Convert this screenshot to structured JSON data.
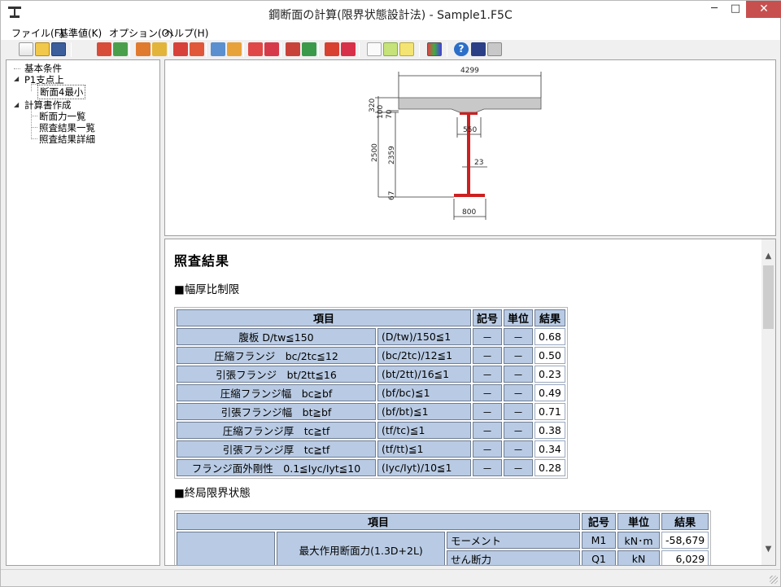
{
  "window": {
    "title": "鋼断面の計算(限界状態設計法) - Sample1.F5C",
    "min": "─",
    "max": "□",
    "close": "✕"
  },
  "menu": [
    "ファイル(F)",
    "基準値(K)",
    "オプション(O)",
    "ヘルプ(H)"
  ],
  "tree": {
    "basic": "基本条件",
    "p1": "P1支点上",
    "section": "断面4最小",
    "report": "計算書作成",
    "forces": "断面力一覧",
    "results": "照査結果一覧",
    "detail": "照査結果詳細"
  },
  "drawing": {
    "top_width": "4299",
    "slab": "320",
    "haunch": "100",
    "flange_top": "70",
    "web_depth": "2500",
    "web_clear": "2359",
    "flange_bot": "67",
    "top_flange_w": "550",
    "web_t": "23",
    "bot_flange_w": "800"
  },
  "results": {
    "heading": "照査結果",
    "sec1": "■幅厚比制限",
    "sec2": "■終局限界状態",
    "t1_head": {
      "item": "項目",
      "symbol": "記号",
      "unit": "単位",
      "result": "結果"
    },
    "t1_rows": [
      {
        "name": "腹板 D/tw≦150",
        "formula": "(D/tw)/150≦1",
        "symbol": "－",
        "unit": "－",
        "value": "0.68"
      },
      {
        "name": "圧縮フランジ　bc/2tc≦12",
        "formula": "(bc/2tc)/12≦1",
        "symbol": "－",
        "unit": "－",
        "value": "0.50"
      },
      {
        "name": "引張フランジ　bt/2tt≦16",
        "formula": "(bt/2tt)/16≦1",
        "symbol": "－",
        "unit": "－",
        "value": "0.23"
      },
      {
        "name": "圧縮フランジ幅　bc≧bf",
        "formula": "(bf/bc)≦1",
        "symbol": "－",
        "unit": "－",
        "value": "0.49"
      },
      {
        "name": "引張フランジ幅　bt≧bf",
        "formula": "(bf/bt)≦1",
        "symbol": "－",
        "unit": "－",
        "value": "0.71"
      },
      {
        "name": "圧縮フランジ厚　tc≧tf",
        "formula": "(tf/tc)≦1",
        "symbol": "－",
        "unit": "－",
        "value": "0.38"
      },
      {
        "name": "引張フランジ厚　tc≧tf",
        "formula": "(tf/tt)≦1",
        "symbol": "－",
        "unit": "－",
        "value": "0.34"
      },
      {
        "name": "フランジ面外剛性　0.1≦Iyc/Iyt≦10",
        "formula": "(Iyc/Iyt)/10≦1",
        "symbol": "－",
        "unit": "－",
        "value": "0.28"
      }
    ],
    "t2_head": {
      "item": "項目",
      "symbol": "記号",
      "unit": "単位",
      "result": "結果"
    },
    "t2_group": "最大作用断面力(1.3D+2L)",
    "t2_rows": [
      {
        "label": "モーメント",
        "symbol": "M1",
        "unit": "kN･m",
        "value": "-58,679"
      },
      {
        "label": "せん断力",
        "symbol": "Q1",
        "unit": "kN",
        "value": "6,029"
      }
    ]
  },
  "colors": {
    "header_cell": "#b9cbe4",
    "close": "#c7504f",
    "steel": "#cc2020"
  }
}
